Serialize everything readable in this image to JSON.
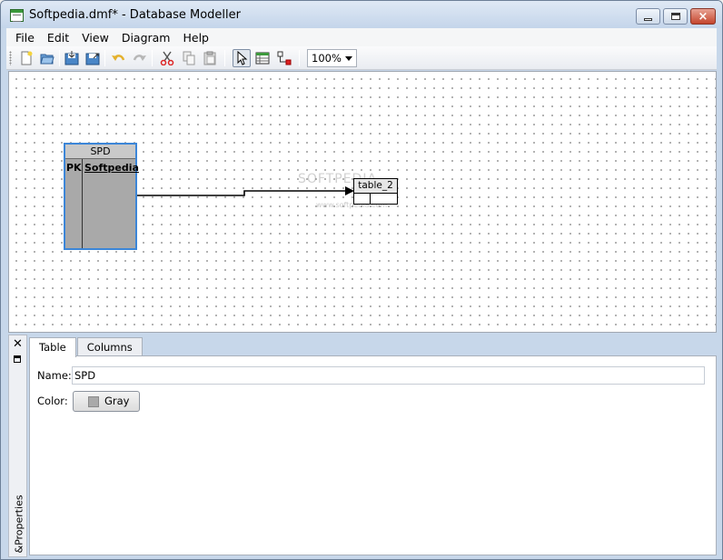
{
  "window": {
    "title": "Softpedia.dmf* - Database Modeller",
    "controls": {
      "minimize": "minimize",
      "maximize": "maximize",
      "close": "×"
    }
  },
  "menu": {
    "items": [
      "File",
      "Edit",
      "View",
      "Diagram",
      "Help"
    ]
  },
  "toolbar": {
    "buttons": [
      "new-file-icon",
      "open-folder-icon",
      "import-icon",
      "export-icon",
      "undo-icon",
      "redo-icon",
      "cut-icon",
      "copy-icon",
      "paste-icon",
      "select-pointer-icon",
      "add-table-icon",
      "add-relation-icon"
    ],
    "zoom": "100%"
  },
  "diagram": {
    "entities": [
      {
        "name": "SPD",
        "pk_label": "PK",
        "field": "Softpedia",
        "selected": true,
        "color": "#a9a9a9"
      },
      {
        "name": "table_2",
        "selected": false,
        "color": "#ffffff"
      }
    ],
    "watermark": "SOFTPEDIA",
    "watermark_sub": "www.softpedia.com"
  },
  "properties": {
    "side_label": "&Properties",
    "tabs": [
      "Table",
      "Columns"
    ],
    "active_tab": "Table",
    "name_label": "Name:",
    "name_value": "SPD",
    "color_label": "Color:",
    "color_value": "Gray",
    "color_swatch": "#a9a9a9"
  },
  "colors": {
    "selection_border": "#3c86d8",
    "close_button": "#c4452d"
  }
}
